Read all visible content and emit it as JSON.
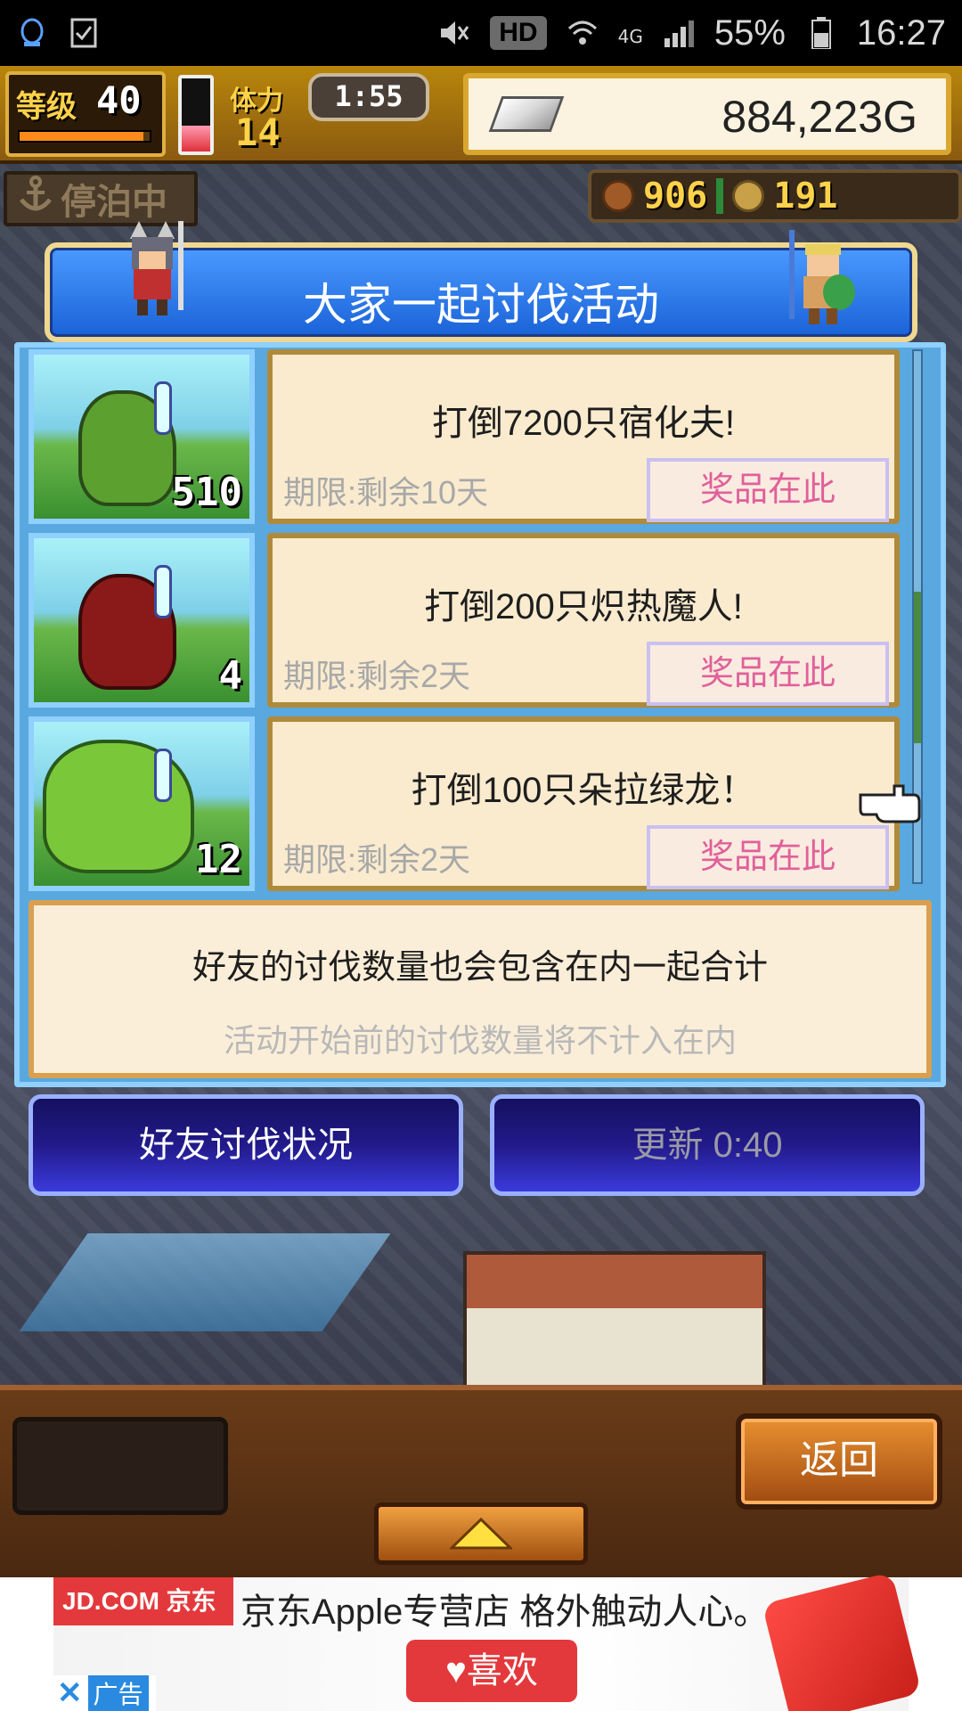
{
  "status_bar": {
    "network": "4G",
    "hd": "HD",
    "battery": "55%",
    "time": "16:27"
  },
  "hud": {
    "level_label": "等级",
    "level_value": "40",
    "stamina_label": "体力",
    "stamina_value": "14",
    "stamina_fraction": 0.35,
    "timer": "1:55",
    "gold": "884,223G",
    "status_label": "停泊中",
    "resource_1": "906",
    "resource_2": "191"
  },
  "event": {
    "title": "大家一起讨伐活动",
    "quests": [
      {
        "title": "打倒7200只宿化夫!",
        "deadline": "期限:剩余10天",
        "prize": "奖品在此",
        "count": "510",
        "monster_color": "#5ca030"
      },
      {
        "title": "打倒200只炽热魔人!",
        "deadline": "期限:剩余2天",
        "prize": "奖品在此",
        "count": "4",
        "monster_color": "#8a1a1a"
      },
      {
        "title": "打倒100只朵拉绿龙！",
        "deadline": "期限:剩余2天",
        "prize": "奖品在此",
        "count": "12",
        "monster_color": "#7ac83a"
      }
    ],
    "info_line1": "好友的讨伐数量也会包含在内一起合计",
    "info_line2": "活动开始前的讨伐数量将不计入在内"
  },
  "buttons": {
    "friend_status": "好友讨伐状况",
    "refresh": "更新 0:40",
    "back": "返回"
  },
  "ad": {
    "brand": "JD.COM 京东",
    "headline": "京东Apple专营店  格外触动人心。",
    "like": "♥喜欢",
    "close_label": "广告"
  },
  "colors": {
    "accent_blue": "#1a62d8",
    "prize_pink": "#e0609a",
    "gold": "#ffd24a"
  }
}
